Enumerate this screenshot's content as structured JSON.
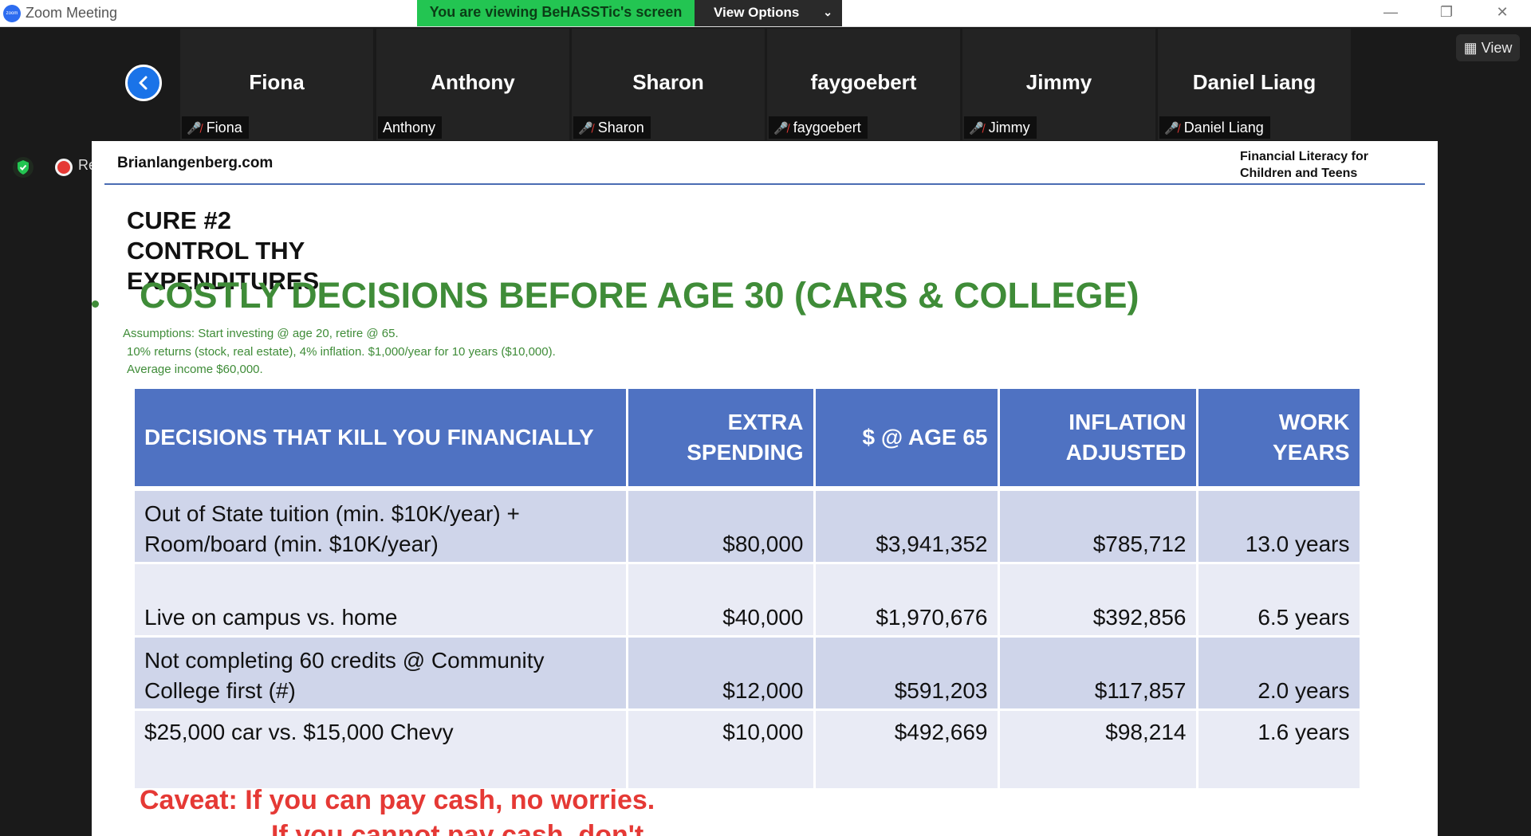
{
  "window": {
    "app_logo": "zoom",
    "title": "Zoom Meeting",
    "share_banner": "You are viewing BeHASSTic's screen",
    "view_options": "View Options",
    "minimize": "—",
    "restore": "❐",
    "close": "✕"
  },
  "gallery": {
    "view_label": "View",
    "participants": [
      {
        "display": "Fiona",
        "tag": "Fiona",
        "muted": true
      },
      {
        "display": "Anthony",
        "tag": "Anthony",
        "muted": false
      },
      {
        "display": "Sharon",
        "tag": "Sharon",
        "muted": true
      },
      {
        "display": "faygoebert",
        "tag": "faygoebert",
        "muted": true
      },
      {
        "display": "Jimmy",
        "tag": "Jimmy",
        "muted": true
      },
      {
        "display": "Daniel Liang",
        "tag": "Daniel Liang",
        "muted": true
      }
    ],
    "recording_text": "Re"
  },
  "slide": {
    "site": "Brianlangenberg.com",
    "course": "Financial Literacy for Children and Teens",
    "cure": "CURE #2\nCONTROL THY\nEXPENDITURES",
    "headline": "COSTLY DECISIONS BEFORE AGE 30 (CARS & COLLEGE)",
    "assumptions": [
      "Assumptions:  Start investing @ age 20, retire @ 65.",
      "10% returns (stock, real estate), 4% inflation.  $1,000/year for 10 years ($10,000).",
      "Average income $60,000."
    ],
    "table": {
      "headers": [
        "DECISIONS THAT KILL YOU FINANCIALLY",
        "EXTRA SPENDING",
        "$ @ AGE 65",
        "INFLATION ADJUSTED",
        "WORK YEARS"
      ],
      "rows": [
        {
          "decision": "Out of State tuition (min. $10K/year) + Room/board (min. $10K/year)",
          "extra": "$80,000",
          "age65": "$3,941,352",
          "inflation": "$785,712",
          "work": "13.0 years"
        },
        {
          "decision": "Live on campus vs. home",
          "extra": "$40,000",
          "age65": "$1,970,676",
          "inflation": "$392,856",
          "work": "6.5 years"
        },
        {
          "decision": "Not completing 60 credits @ Community College first (#)",
          "extra": "$12,000",
          "age65": "$591,203",
          "inflation": "$117,857",
          "work": "2.0 years"
        },
        {
          "decision": "$25,000 car vs. $15,000 Chevy",
          "extra": "$10,000",
          "age65": "$492,669",
          "inflation": "$98,214",
          "work": "1.6 years"
        }
      ]
    },
    "caveat": "Caveat:  If you can pay cash, no worries.",
    "caveat2": "If you cannot pay cash, don't."
  }
}
